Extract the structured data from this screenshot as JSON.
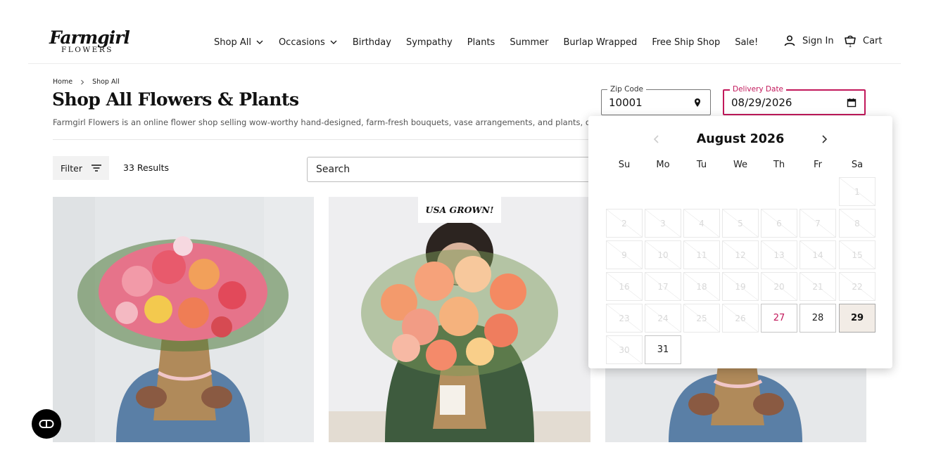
{
  "brand": {
    "logo_script": "Farmgirl",
    "logo_sub": "FLOWERS"
  },
  "nav": [
    {
      "label": "Shop All",
      "has_dropdown": true
    },
    {
      "label": "Occasions",
      "has_dropdown": true
    },
    {
      "label": "Birthday",
      "has_dropdown": false
    },
    {
      "label": "Sympathy",
      "has_dropdown": false
    },
    {
      "label": "Plants",
      "has_dropdown": false
    },
    {
      "label": "Summer",
      "has_dropdown": false
    },
    {
      "label": "Burlap Wrapped",
      "has_dropdown": false
    },
    {
      "label": "Free Ship Shop",
      "has_dropdown": false
    },
    {
      "label": "Sale!",
      "has_dropdown": false
    }
  ],
  "account": {
    "signin_label": "Sign In",
    "cart_label": "Cart",
    "cart_count": "1"
  },
  "breadcrumb": [
    "Home",
    "Shop All"
  ],
  "page": {
    "title": "Shop All Flowers & Plants",
    "description": "Farmgirl Flowers is an online flower shop selling wow-worthy hand-designed, farm-fresh bouquets, vase arrangements, and plants, delivered nationwide."
  },
  "zip": {
    "label": "Zip Code",
    "value": "10001"
  },
  "delivery": {
    "label": "Delivery Date",
    "value": "08/29/2026"
  },
  "toolbar": {
    "filter_label": "Filter",
    "results_label": "33 Results",
    "search_placeholder": "Search"
  },
  "products": [
    {
      "badge": ""
    },
    {
      "badge": "USA GROWN!"
    },
    {
      "badge": ""
    }
  ],
  "calendar": {
    "month_label": "August 2026",
    "weekdays": [
      "Su",
      "Mo",
      "Tu",
      "We",
      "Th",
      "Fr",
      "Sa"
    ],
    "first_weekday_index": 6,
    "days_in_month": 31,
    "available_days": [
      27,
      28,
      29,
      31
    ],
    "today": 27,
    "selected": 29
  },
  "colors": {
    "accent": "#c2185b",
    "selected_bg": "#f2ece6",
    "text": "#1a1a1a"
  }
}
